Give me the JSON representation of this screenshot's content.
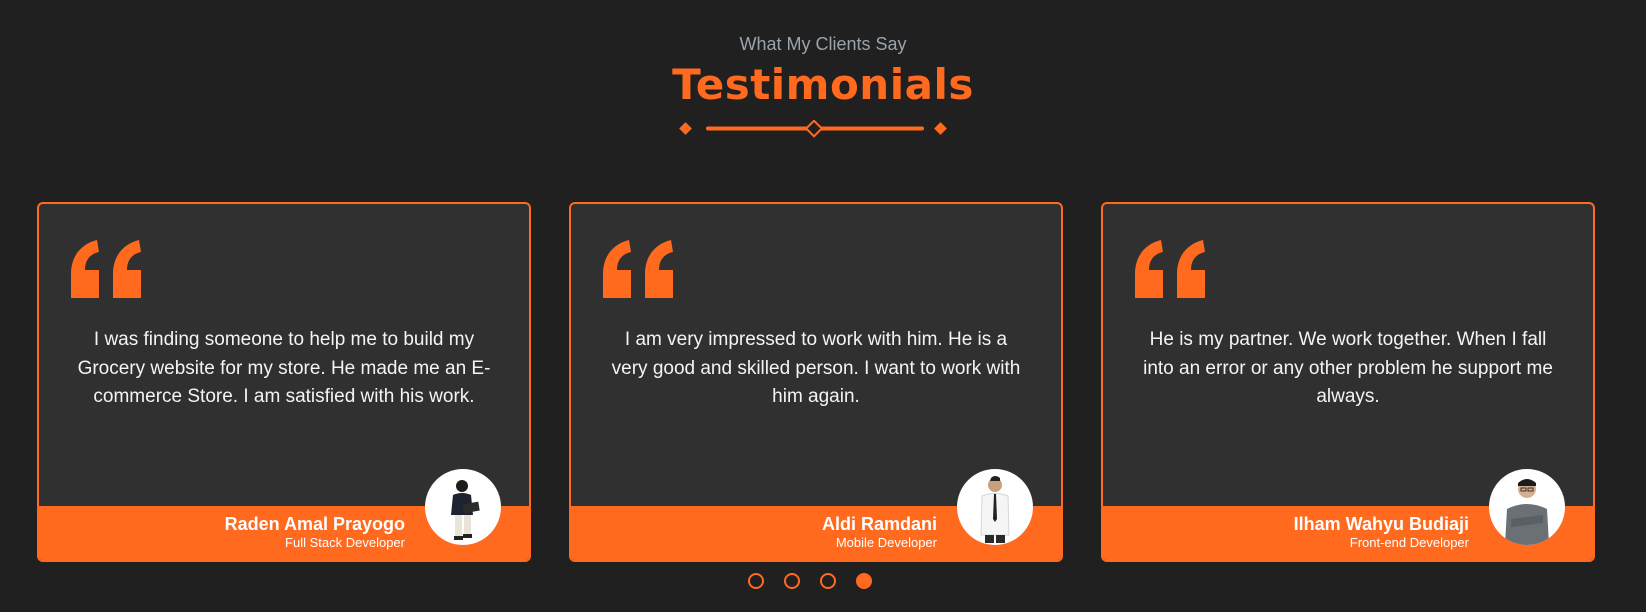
{
  "header": {
    "eyebrow": "What My Clients Say",
    "title": "Testimonials"
  },
  "accent_color": "#ff6a1f",
  "background_color": "#202020",
  "card_color": "#303030",
  "testimonials": [
    {
      "quote_icon": "quote-icon",
      "text": "I was finding someone to help me to build my Grocery website for my store. He made me an E-commerce Store. I am satisfied with his work.",
      "name": "Raden Amal Prayogo",
      "role": "Full Stack Developer",
      "avatar_icon": "person-with-laptop"
    },
    {
      "quote_icon": "quote-icon",
      "text": "I am very impressed to work with him. He is a very good and skilled person. I want to work with him again.",
      "name": "Aldi Ramdani",
      "role": "Mobile Developer",
      "avatar_icon": "person-in-shirt-and-tie"
    },
    {
      "quote_icon": "quote-icon",
      "text": "He is my partner. We work together. When I fall into an error or any other problem he support me always.",
      "name": "Ilham Wahyu Budiaji",
      "role": "Front-end Developer",
      "avatar_icon": "person-arms-crossed"
    }
  ],
  "pagination": {
    "count": 4,
    "active_index": 3
  }
}
